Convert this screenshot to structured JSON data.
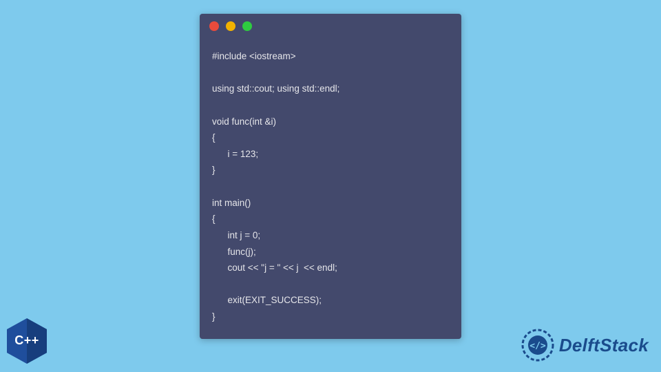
{
  "window": {
    "dots": {
      "red": "#e94b3c",
      "yellow": "#f2b200",
      "green": "#2ecc40"
    },
    "code": "#include <iostream>\n\nusing std::cout; using std::endl;\n\nvoid func(int &i)\n{\n      i = 123;\n}\n\nint main()\n{\n      int j = 0;\n      func(j);\n      cout << \"j = \" << j  << endl;\n\n      exit(EXIT_SUCCESS);\n}"
  },
  "badge": {
    "label": "C++"
  },
  "brand": {
    "name": "DelftStack"
  },
  "colors": {
    "page_bg": "#7ecaed",
    "window_bg": "#43496c",
    "code_fg": "#e6e6ea",
    "brand_fg": "#1a4b8c",
    "cpp_hex": "#1f4e9c"
  }
}
